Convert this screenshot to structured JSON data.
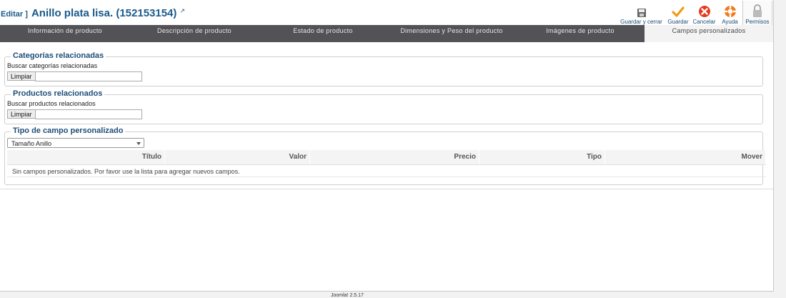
{
  "header": {
    "prefix": "Editar ]",
    "title": "Anillo plata lisa. (152153154)",
    "external_icon": "external-link-icon"
  },
  "toolbar": {
    "buttons": [
      {
        "label": "Guardar y cerrar",
        "icon": "save-disk-icon"
      },
      {
        "label": "Guardar",
        "icon": "checkmark-icon",
        "color": "#f29a1a"
      },
      {
        "label": "Cancelar",
        "icon": "cancel-icon",
        "color": "#e53b1e"
      },
      {
        "label": "Ayuda",
        "icon": "lifebuoy-icon",
        "color": "#f07a1c"
      },
      {
        "label": "Permisos",
        "icon": "lock-icon"
      }
    ]
  },
  "tabs": [
    {
      "label": "Información de producto"
    },
    {
      "label": "Descripción de producto"
    },
    {
      "label": "Estado de producto"
    },
    {
      "label": "Dimensiones y Peso del producto"
    },
    {
      "label": "Imágenes de producto"
    },
    {
      "label": "Campos personalizados",
      "active": true
    }
  ],
  "categories": {
    "legend": "Categorías relacionadas",
    "search_label": "Buscar categorías relacionadas",
    "clear_label": "Limpiar",
    "input_value": ""
  },
  "products": {
    "legend": "Productos relacionados",
    "search_label": "Buscar productos relacionados",
    "clear_label": "Limpiar",
    "input_value": ""
  },
  "custom_fields": {
    "legend": "Tipo de campo personalizado",
    "selected": "Tamaño Anillo",
    "columns": [
      "Título",
      "Valor",
      "Precio",
      "Tipo",
      "Mover"
    ],
    "empty_message": "Sin campos personalizados. Por favor use la lista para agregar nuevos campos."
  },
  "footer": {
    "version": "Joomla! 2.5.17"
  },
  "colors": {
    "tabs_bg": "#535357",
    "title": "#1a5a8a",
    "legend": "#1f4e79"
  }
}
